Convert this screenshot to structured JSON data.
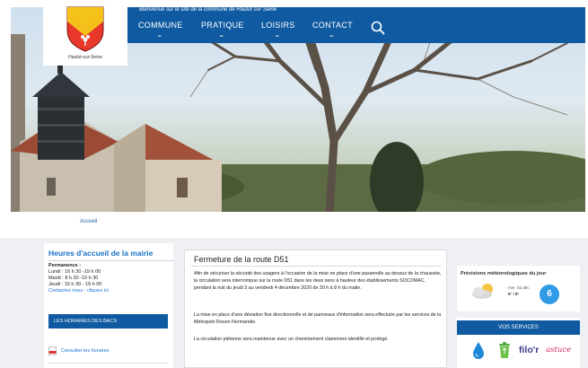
{
  "header": {
    "welcome_text": "Bienvenue sur le site de la commune de Hautot sur Seine",
    "logo_caption": "Hautot-sur-Seine",
    "nav": [
      {
        "label": "COMMUNE"
      },
      {
        "label": "PRATIQUE"
      },
      {
        "label": "LOISIRS"
      },
      {
        "label": "CONTACT"
      }
    ],
    "search_icon": "search-icon",
    "brand_color": "#0f5aa0"
  },
  "breadcrumb": {
    "home": "Accueil"
  },
  "left": {
    "hours_title": "Heures d'accueil de la mairie",
    "permanence_label": "Permanence :",
    "lines": [
      "Lundi : 16 h 30 -19 h 00",
      "Mardi : 8 h 30 -10 h 30",
      "Jeudi : 16 h 30 - 19 h 00"
    ],
    "contact_link": "Contactez nous - cliquez ici",
    "bacs_title": "LES HORAIRES DES BACS",
    "horaires_link": "Consulter les horaires"
  },
  "article": {
    "title": "Fermeture de la route D51",
    "paragraphs": [
      "Afin de sécuriser la sécurité des usagers à l'occasion de la mise ne place d'une passerelle au dessus de la chaussée, la circulation sera interrompue sur la route D51 dans les deux sens à hauteur des établissements SOCOMAC, pendant la nuit du jeudi 3 au vendredi 4 décembre 2020 de 20 h à 8 h du matin.",
      "La mise en place d'une déviation fixe directionnelle et de panneaux d'information sera effectuée par les services de la Métropole Rouen Normandie.",
      "La circulation piétonne sera maintenue avec un cheminement clairement identifié et protégé."
    ]
  },
  "weather": {
    "title": "Prévisions météorologiques du jour",
    "date": "mer. 02 déc.",
    "temps": "6° / 8°",
    "badge": "6",
    "icon": "partly-cloudy-icon"
  },
  "services": {
    "title": "VOS SERVICES",
    "filor": "filo'r",
    "astuce": "astuce",
    "icons": [
      "water-drop-icon",
      "recycle-bin-icon"
    ]
  }
}
